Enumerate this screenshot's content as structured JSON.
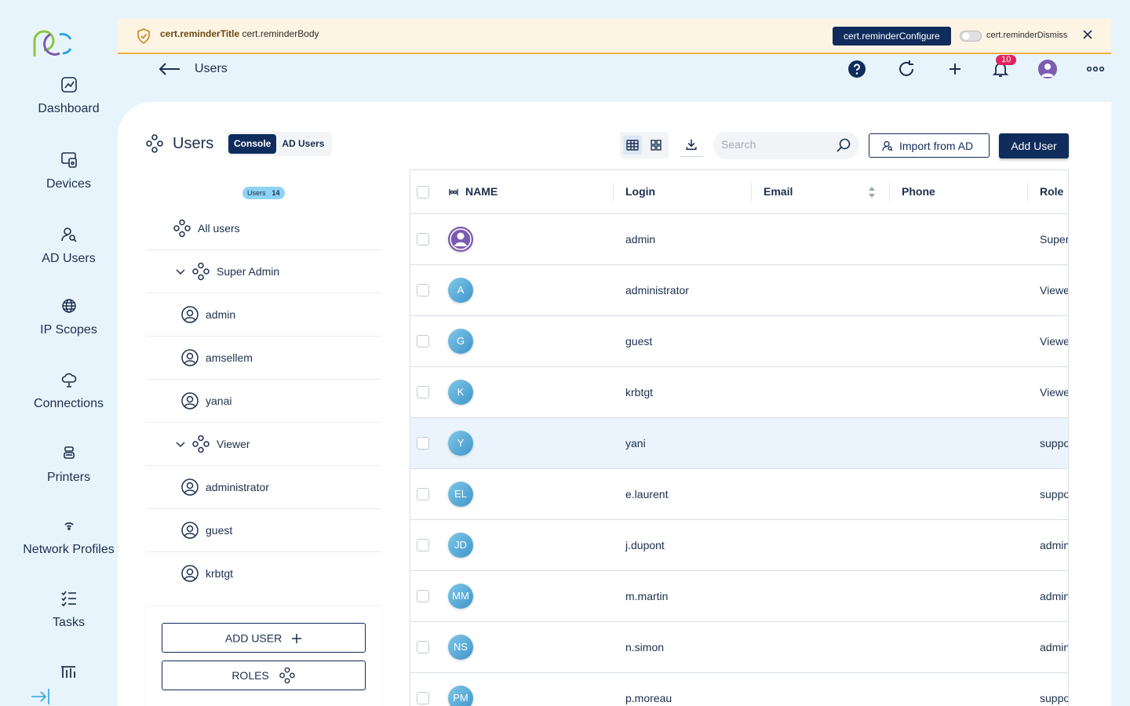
{
  "sidebar": {
    "items": [
      {
        "label": "Dashboard",
        "icon": "dashboard-icon"
      },
      {
        "label": "Devices",
        "icon": "devices-icon"
      },
      {
        "label": "AD Users",
        "icon": "ad-users-icon"
      },
      {
        "label": "IP Scopes",
        "icon": "globe-icon"
      },
      {
        "label": "Connections",
        "icon": "cloud-icon"
      },
      {
        "label": "Printers",
        "icon": "printer-icon"
      },
      {
        "label": "Network Profiles",
        "icon": "wifi-icon"
      },
      {
        "label": "Tasks",
        "icon": "tasks-icon"
      }
    ]
  },
  "banner": {
    "title": "cert.reminderTitle",
    "body": "cert.reminderBody",
    "configure": "cert.reminderConfigure",
    "dismiss": "cert.reminderDismiss"
  },
  "topbar": {
    "title": "Users",
    "notification_count": "10"
  },
  "main": {
    "title": "Users",
    "tabs": [
      {
        "label": "Console",
        "active": true
      },
      {
        "label": "AD Users",
        "active": false
      }
    ],
    "search_placeholder": "Search",
    "import_label": "Import from AD",
    "add_label": "Add User"
  },
  "tree": {
    "badge_label": "Users",
    "badge_count": "14",
    "rows": [
      {
        "label": "All users",
        "type": "group",
        "chevron": false
      },
      {
        "label": "Super Admin",
        "type": "group",
        "chevron": true
      },
      {
        "label": "admin",
        "type": "user",
        "chevron": false
      },
      {
        "label": "amsellem",
        "type": "user",
        "chevron": false
      },
      {
        "label": "yanai",
        "type": "user",
        "chevron": false
      },
      {
        "label": "Viewer",
        "type": "group",
        "chevron": true
      },
      {
        "label": "administrator",
        "type": "user",
        "chevron": false
      },
      {
        "label": "guest",
        "type": "user",
        "chevron": false
      },
      {
        "label": "krbtgt",
        "type": "user",
        "chevron": false
      }
    ],
    "add_user_label": "ADD USER",
    "roles_label": "ROLES"
  },
  "table": {
    "columns": [
      "NAME",
      "Login",
      "Email",
      "Phone",
      "Role"
    ],
    "rows": [
      {
        "initials": "",
        "avatar_image": true,
        "login": "admin",
        "role": "Super"
      },
      {
        "initials": "A",
        "login": "administrator",
        "role": "Viewe"
      },
      {
        "initials": "G",
        "login": "guest",
        "role": "Viewe"
      },
      {
        "initials": "K",
        "login": "krbtgt",
        "role": "Viewe"
      },
      {
        "initials": "Y",
        "login": "yani",
        "role": "suppo",
        "highlighted": true
      },
      {
        "initials": "EL",
        "login": "e.laurent",
        "role": "suppo"
      },
      {
        "initials": "JD",
        "login": "j.dupont",
        "role": "admin"
      },
      {
        "initials": "MM",
        "login": "m.martin",
        "role": "admin"
      },
      {
        "initials": "NS",
        "login": "n.simon",
        "role": "admin"
      },
      {
        "initials": "PM",
        "login": "p.moreau",
        "role": "suppo"
      }
    ]
  },
  "colors": {
    "primary": "#0f2c5c",
    "background": "#e8f4fb",
    "banner_bg": "#fdf4e3",
    "banner_border": "#f0b13c",
    "badge": "#e0245e",
    "highlight_row": "#ebf4fd"
  }
}
